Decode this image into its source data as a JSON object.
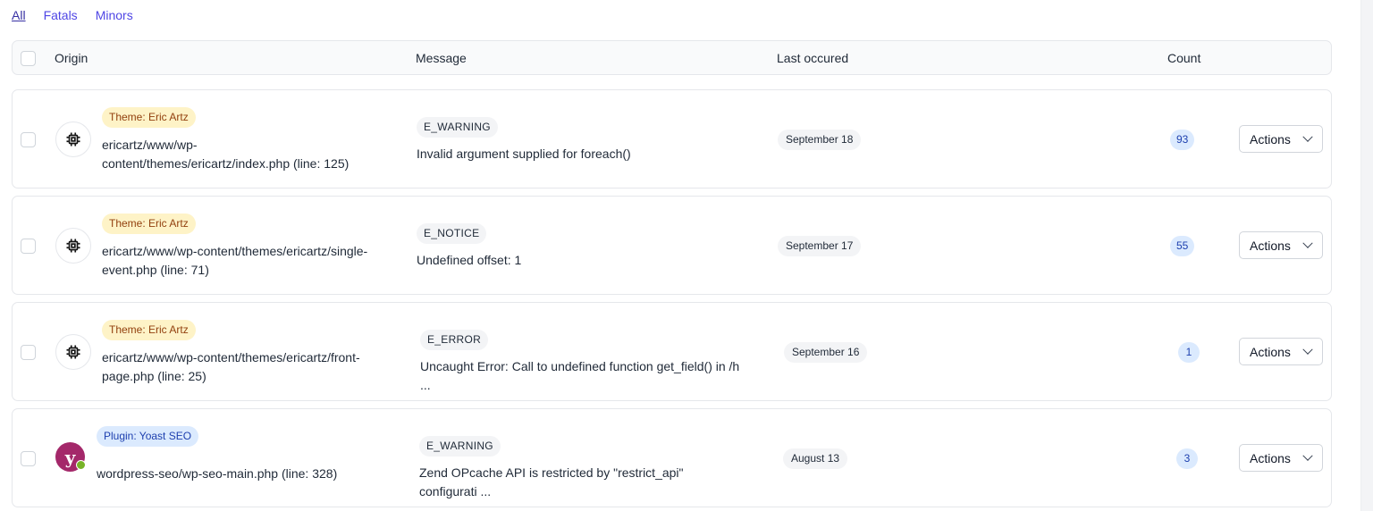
{
  "filters": [
    {
      "label": "All",
      "active": true
    },
    {
      "label": "Fatals",
      "active": false
    },
    {
      "label": "Minors",
      "active": false
    }
  ],
  "columns": {
    "origin": "Origin",
    "message": "Message",
    "last_occured": "Last occured",
    "count": "Count"
  },
  "actions_label": "Actions",
  "icons": {
    "theme": "cpu-chip-icon",
    "plugin": "yoast-logo-icon",
    "dropdown": "chevron-down-icon"
  },
  "colors": {
    "theme_badge_bg": "#fef3c7",
    "theme_badge_text": "#92400e",
    "plugin_badge_bg": "#dbeafe",
    "count_badge_bg": "#dbeafe",
    "link": "#4f46e5",
    "yoast": "#a4286a"
  },
  "rows": [
    {
      "origin_badge": "Theme: Eric Artz",
      "origin_path": "ericartz/www/wp-\ncontent/themes/ericartz/index.php (line: 125)",
      "type": "E_WARNING",
      "message": "Invalid argument supplied for foreach()",
      "last_occured": "September 18",
      "count": "93"
    },
    {
      "origin_badge": "Theme: Eric Artz",
      "origin_path": "ericartz/www/wp-content/themes/ericartz/single-event.php (line: 71)",
      "type": "E_NOTICE",
      "message": "Undefined offset: 1",
      "last_occured": "September 17",
      "count": "55"
    },
    {
      "origin_badge": "Theme: Eric Artz",
      "origin_path": "ericartz/www/wp-content/themes/ericartz/front-page.php (line: 25)",
      "type": "E_ERROR",
      "message": "Uncaught Error: Call to undefined function get_field() in /h\n...",
      "last_occured": "September 16",
      "count": "1"
    },
    {
      "origin_badge": "Plugin: Yoast SEO",
      "origin_path": "wordpress-seo/wp-seo-main.php (line: 328)",
      "type": "E_WARNING",
      "message": "Zend OPcache API is restricted by \"restrict_api\"\nconfigurati ...",
      "last_occured": "August 13",
      "count": "3"
    }
  ]
}
